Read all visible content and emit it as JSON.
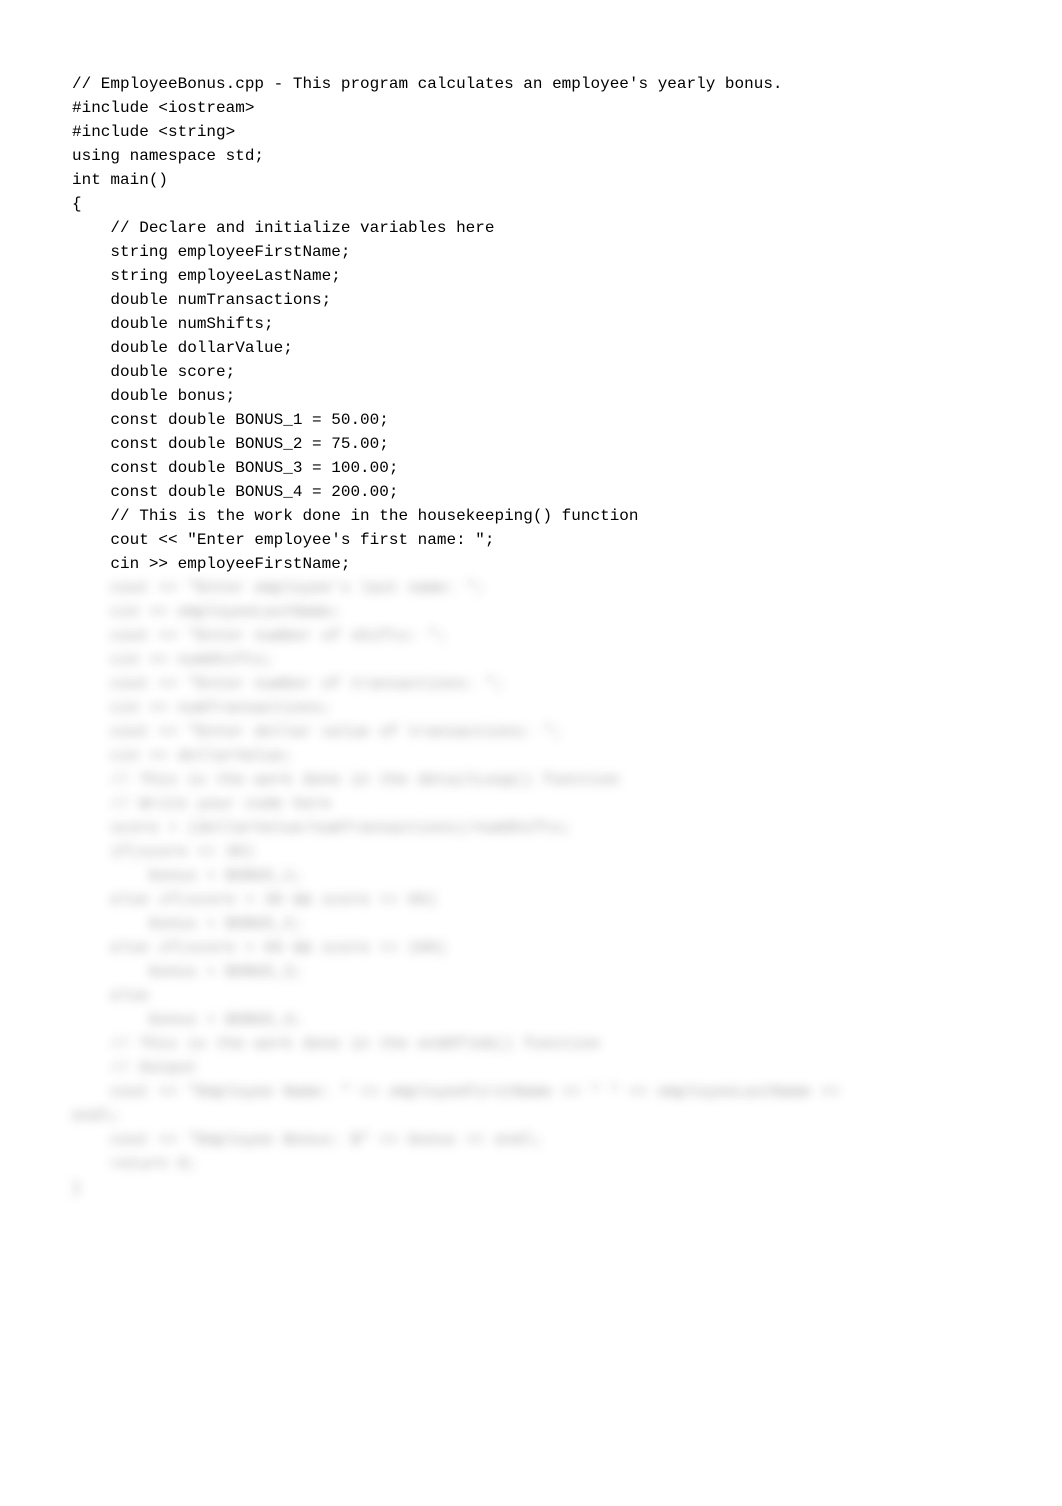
{
  "code": {
    "lines": [
      "// EmployeeBonus.cpp - This program calculates an employee's yearly bonus.",
      "",
      "#include <iostream>",
      "#include <string>",
      "using namespace std;",
      "int main()",
      "{",
      "    // Declare and initialize variables here",
      "    string employeeFirstName;",
      "    string employeeLastName;",
      "    double numTransactions;",
      "    double numShifts;",
      "    double dollarValue;",
      "    double score;",
      "    double bonus;",
      "    const double BONUS_1 = 50.00;",
      "    const double BONUS_2 = 75.00;",
      "    const double BONUS_3 = 100.00;",
      "    const double BONUS_4 = 200.00;",
      "",
      "    // This is the work done in the housekeeping() function",
      "    cout << \"Enter employee's first name: \";",
      "    cin >> employeeFirstName;"
    ]
  },
  "obscured": {
    "lines": [
      "    cout << \"Enter employee's last name: \";",
      "    cin >> employeeLastName;",
      "    cout << \"Enter number of shifts: \";",
      "    cin >> numShifts;",
      "    cout << \"Enter number of transactions: \";",
      "    cin >> numTransactions;",
      "    cout << \"Enter dollar value of transactions: \";",
      "    cin >> dollarValue;",
      "",
      "    // This is the work done in the detailLoop() function",
      "    // Write your code here",
      "    score = (dollarValue/numTransactions)/numShifts;",
      "",
      "    if(score <= 30)",
      "        bonus = BONUS_1;",
      "    else if(score > 30 && score <= 69)",
      "        bonus = BONUS_2;",
      "    else if(score > 69 && score <= 199)",
      "        bonus = BONUS_3;",
      "    else",
      "        bonus = BONUS_4;",
      "",
      "    // This is the work done in the endOfJob() function",
      "    // Output",
      "    cout << \"Employee Name: \" << employeeFirstName << \" \" << employeeLastName <<",
      "endl;",
      "    cout << \"Employee Bonus: $\" << bonus << endl;",
      "    return 0;",
      "}"
    ]
  }
}
